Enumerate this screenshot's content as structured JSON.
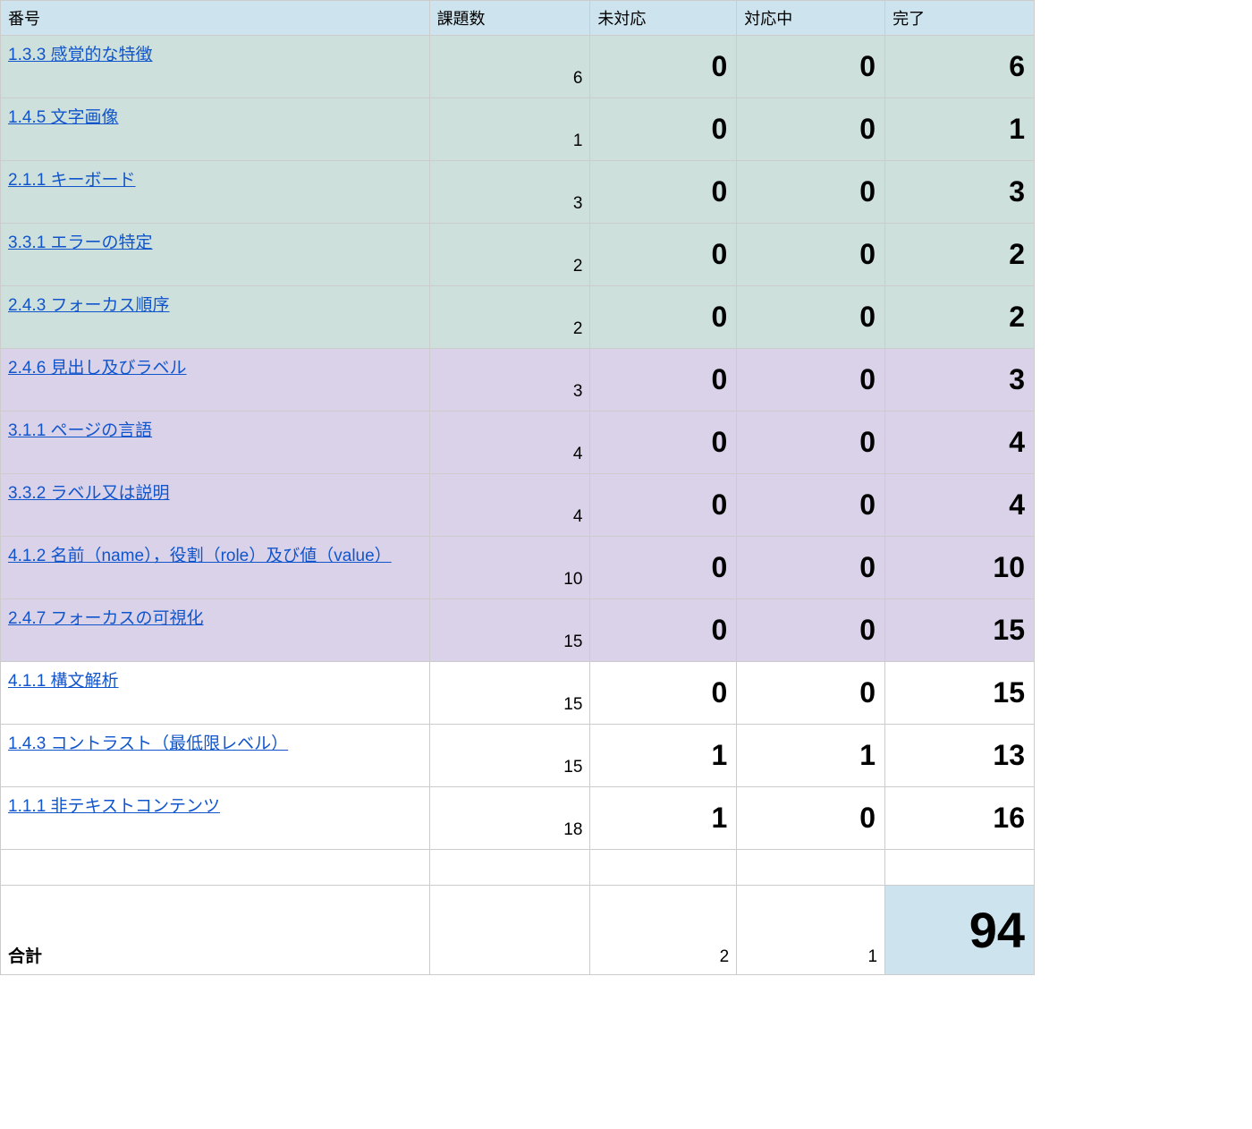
{
  "headers": {
    "number": "番号",
    "issues": "課題数",
    "open": "未対応",
    "inprog": "対応中",
    "done": "完了"
  },
  "rows": [
    {
      "group": "teal",
      "label": "1.3.3 感覚的な特徴",
      "issues": "6",
      "open": "0",
      "inprog": "0",
      "done": "6"
    },
    {
      "group": "teal",
      "label": "1.4.5 文字画像",
      "issues": "1",
      "open": "0",
      "inprog": "0",
      "done": "1"
    },
    {
      "group": "teal",
      "label": "2.1.1 キーボード",
      "issues": "3",
      "open": "0",
      "inprog": "0",
      "done": "3"
    },
    {
      "group": "teal",
      "label": "3.3.1 エラーの特定",
      "issues": "2",
      "open": "0",
      "inprog": "0",
      "done": "2"
    },
    {
      "group": "teal",
      "label": "2.4.3 フォーカス順序",
      "issues": "2",
      "open": "0",
      "inprog": "0",
      "done": "2"
    },
    {
      "group": "lav",
      "label": "2.4.6 見出し及びラベル",
      "issues": "3",
      "open": "0",
      "inprog": "0",
      "done": "3"
    },
    {
      "group": "lav",
      "label": "3.1.1 ページの言語",
      "issues": "4",
      "open": "0",
      "inprog": "0",
      "done": "4"
    },
    {
      "group": "lav",
      "label": "3.3.2 ラベル又は説明",
      "issues": "4",
      "open": "0",
      "inprog": "0",
      "done": "4"
    },
    {
      "group": "lav",
      "label": "4.1.2 名前（name），役割（role）及び値（value）",
      "issues": "10",
      "open": "0",
      "inprog": "0",
      "done": "10"
    },
    {
      "group": "lav",
      "label": "2.4.7 フォーカスの可視化",
      "issues": "15",
      "open": "0",
      "inprog": "0",
      "done": "15"
    },
    {
      "group": "white",
      "label": "4.1.1 構文解析",
      "issues": "15",
      "open": "0",
      "inprog": "0",
      "done": "15"
    },
    {
      "group": "white",
      "label": "1.4.3 コントラスト（最低限レベル）",
      "issues": "15",
      "open": "1",
      "inprog": "1",
      "done": "13"
    },
    {
      "group": "white",
      "label": "1.1.1 非テキストコンテンツ",
      "issues": "18",
      "open": "1",
      "inprog": "0",
      "done": "16"
    }
  ],
  "total": {
    "label": "合計",
    "issues": "",
    "open": "2",
    "inprog": "1",
    "done": "94"
  }
}
